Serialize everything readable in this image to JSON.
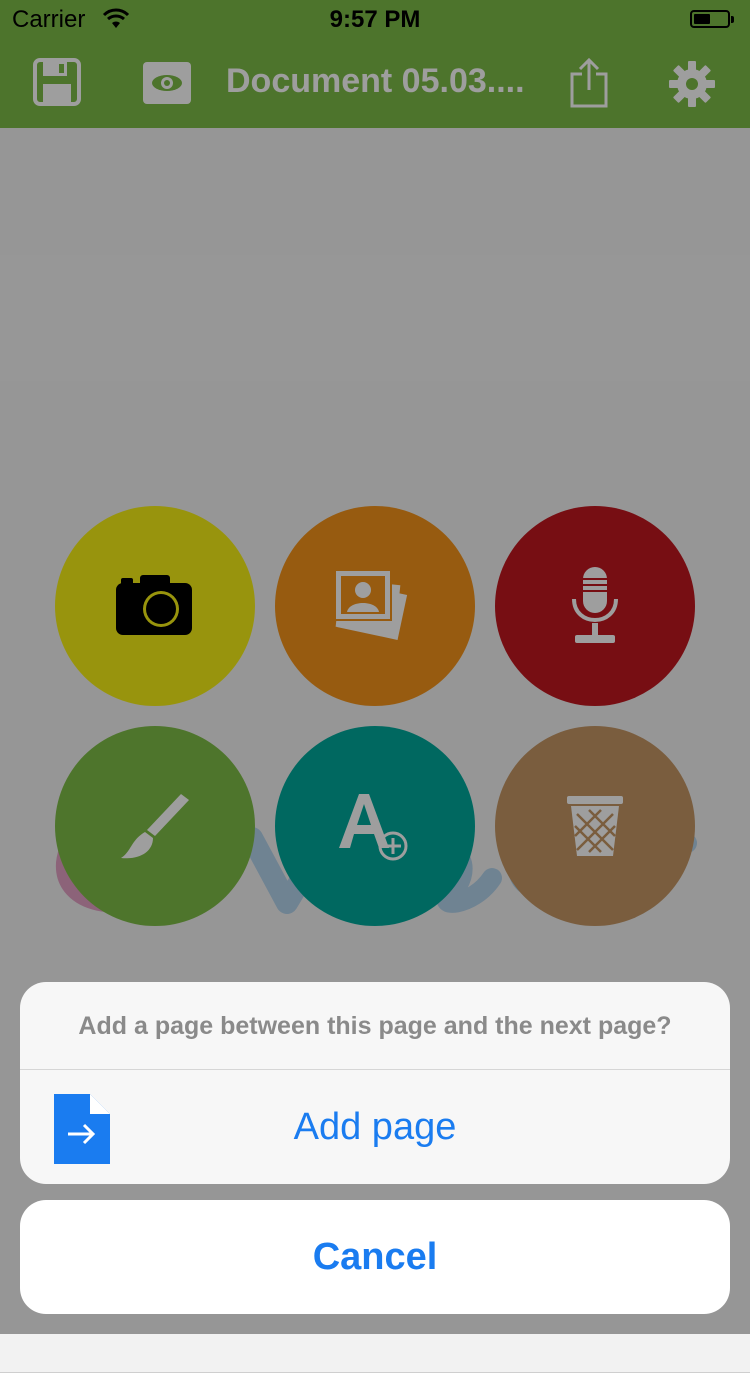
{
  "status_bar": {
    "carrier": "Carrier",
    "time": "9:57 PM"
  },
  "nav": {
    "title": "Document 05.03....",
    "icons": [
      "save-icon",
      "eye-icon",
      "share-icon",
      "gear-icon"
    ]
  },
  "actions": [
    {
      "name": "camera-icon",
      "color": "#f5ef15"
    },
    {
      "name": "photos-icon",
      "color": "#f4931a"
    },
    {
      "name": "microphone-icon",
      "color": "#c0181f"
    },
    {
      "name": "brush-icon",
      "color": "#7ebd47"
    },
    {
      "name": "add-text-icon",
      "color": "#00a99b"
    },
    {
      "name": "trash-icon",
      "color": "#c59765"
    }
  ],
  "action_sheet": {
    "message": "Add a page between this page and the next page?",
    "add_page_label": "Add page",
    "cancel_label": "Cancel"
  },
  "colors": {
    "brand_green": "#7dbb47",
    "ios_blue": "#1a7cf0"
  }
}
